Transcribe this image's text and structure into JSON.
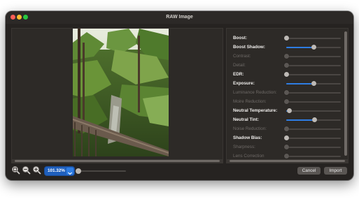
{
  "window": {
    "title": "RAW Image"
  },
  "colors": {
    "accent": "#2e7de3",
    "close": "#ff5f57",
    "minimize": "#febc2e",
    "zoom": "#28c840"
  },
  "preview": {
    "image_name": "tropical-garden-photo"
  },
  "settings": [
    {
      "label": "Boost:",
      "enabled": true,
      "value": 0.0
    },
    {
      "label": "Boost Shadow:",
      "enabled": true,
      "value": 0.5
    },
    {
      "label": "Contrast:",
      "enabled": false,
      "value": 0.0
    },
    {
      "label": "Detail:",
      "enabled": false,
      "value": 0.0
    },
    {
      "label": "EDR:",
      "enabled": true,
      "value": 0.0
    },
    {
      "label": "Exposure:",
      "enabled": true,
      "value": 0.5
    },
    {
      "label": "Luminance Reduction:",
      "enabled": false,
      "value": 0.0
    },
    {
      "label": "Moire Reduction:",
      "enabled": false,
      "value": 0.0
    },
    {
      "label": "Neutral Temperature:",
      "enabled": true,
      "value": 0.06
    },
    {
      "label": "Neutral Tint:",
      "enabled": true,
      "value": 0.52
    },
    {
      "label": "Noise Reduction:",
      "enabled": false,
      "value": 0.0
    },
    {
      "label": "Shadow Bias:",
      "enabled": true,
      "value": 0.0
    },
    {
      "label": "Sharpness:",
      "enabled": false,
      "value": 0.0
    },
    {
      "label": "Lens Correction",
      "enabled": false,
      "value": 0.0
    }
  ],
  "zoom": {
    "value": "101.32%",
    "slider_level": 0.0,
    "icons": [
      "zoom-to-fit-icon",
      "zoom-out-icon",
      "zoom-in-icon"
    ]
  },
  "buttons": {
    "cancel": "Cancel",
    "import": "Import"
  }
}
